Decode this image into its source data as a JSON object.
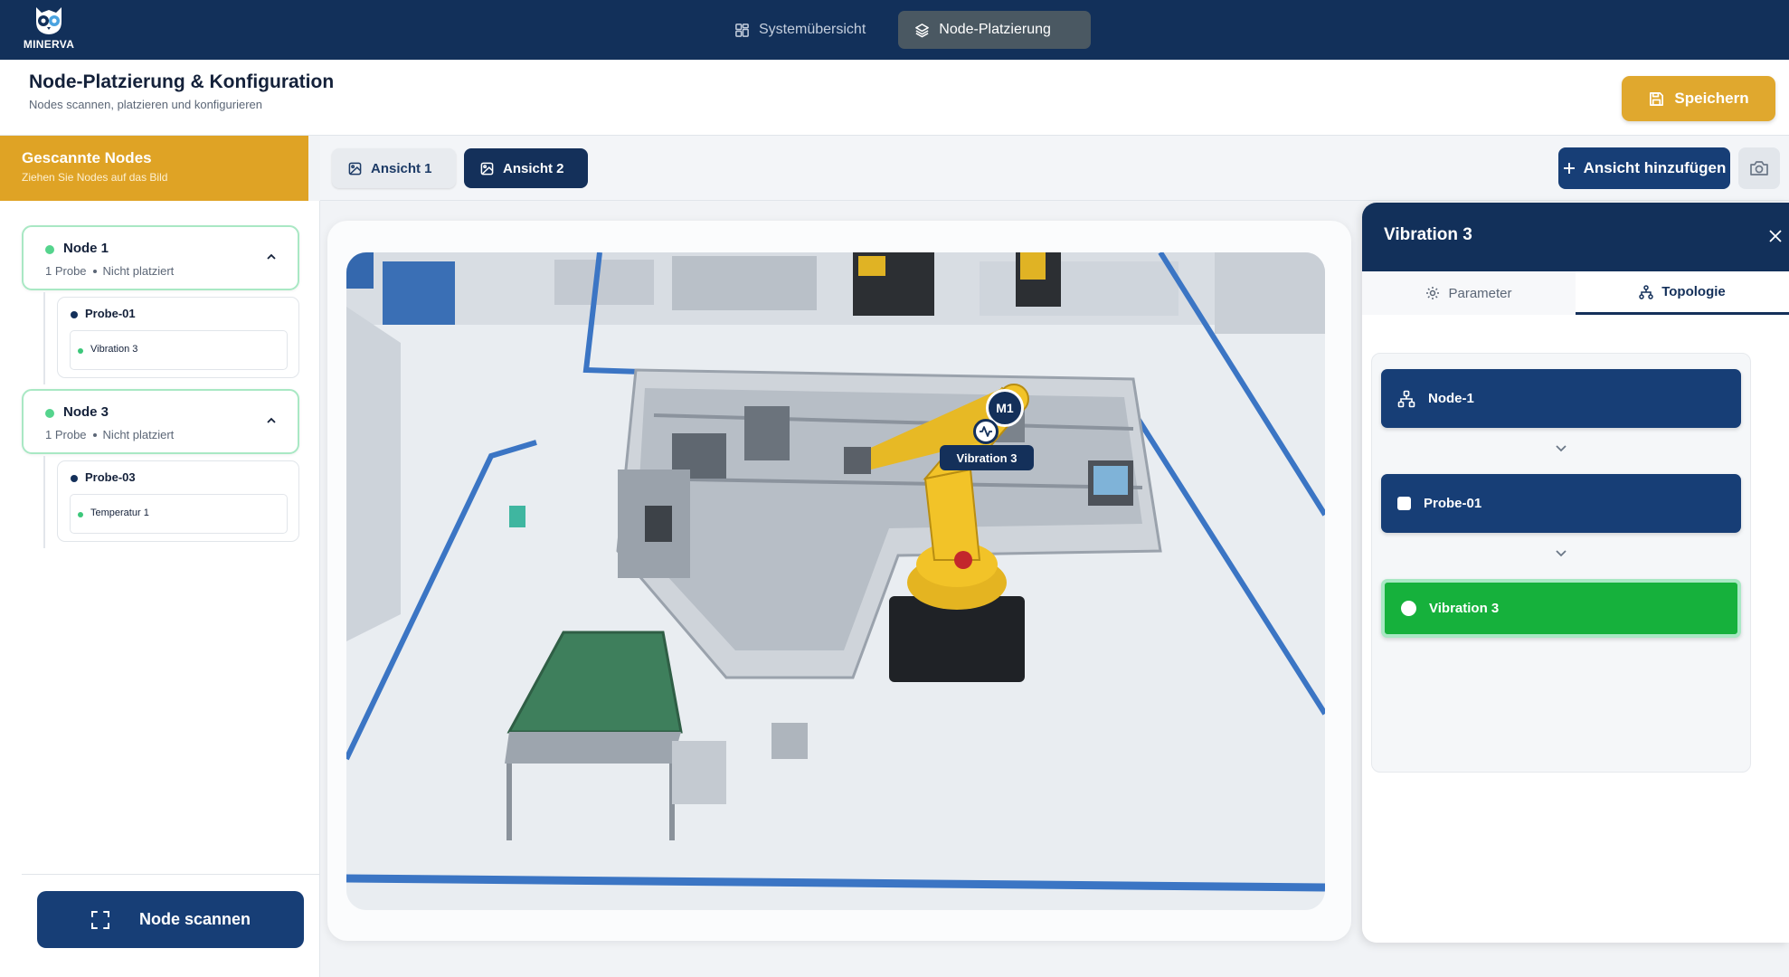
{
  "app": {
    "brand": "MINERVA"
  },
  "nav": {
    "tabs": [
      {
        "label": "Systemübersicht",
        "icon": "dashboard-icon",
        "active": false
      },
      {
        "label": "Node-Platzierung",
        "icon": "layers-icon",
        "active": true
      }
    ]
  },
  "header": {
    "title": "Node-Platzierung & Konfiguration",
    "subtitle": "Nodes scannen, platzieren und konfigurieren",
    "save_label": "Speichern"
  },
  "left_panel": {
    "title": "Gescannte Nodes",
    "subtitle": "Ziehen Sie Nodes auf das Bild",
    "nodes": [
      {
        "name": "Node 1",
        "probe_count": "1 Probe",
        "status": "Nicht platziert",
        "probe": {
          "name": "Probe-01",
          "sensor": "Vibration 3"
        }
      },
      {
        "name": "Node 3",
        "probe_count": "1 Probe",
        "status": "Nicht platziert",
        "probe": {
          "name": "Probe-03",
          "sensor": "Temperatur 1"
        }
      }
    ],
    "scan_label": "Node scannen"
  },
  "views": {
    "tabs": [
      {
        "label": "Ansicht 1",
        "active": false
      },
      {
        "label": "Ansicht 2",
        "active": true
      }
    ],
    "add_label": "Ansicht hinzufügen"
  },
  "canvas": {
    "marker_badge": "M1",
    "marker_label": "Vibration 3"
  },
  "detail_panel": {
    "title": "Vibration 3",
    "tabs": [
      {
        "label": "Parameter",
        "active": false
      },
      {
        "label": "Topologie",
        "active": true
      }
    ],
    "topology": [
      {
        "label": "Node-1",
        "kind": "node"
      },
      {
        "label": "Probe-01",
        "kind": "probe"
      },
      {
        "label": "Vibration 3",
        "kind": "sensor"
      }
    ]
  },
  "colors": {
    "navy": "#12305a",
    "accent_gold": "#dfa325",
    "success_green": "#16b13c",
    "node_border": "#a9e8c4"
  }
}
